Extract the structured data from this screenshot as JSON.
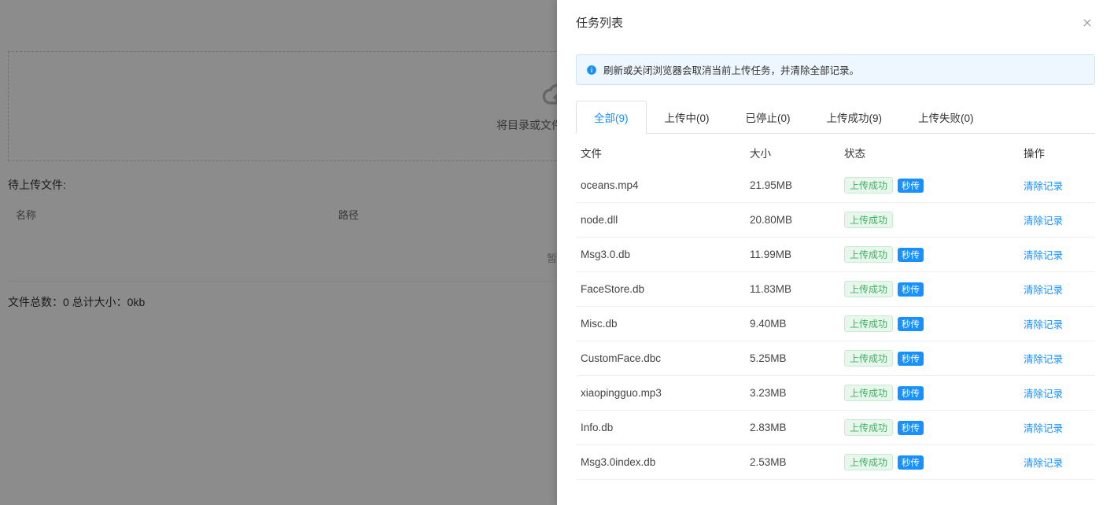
{
  "drawer": {
    "title": "任务列表",
    "alert": "刷新或关闭浏览器会取消当前上传任务，并清除全部记录。"
  },
  "tabs": [
    {
      "label": "全部(9)",
      "active": true
    },
    {
      "label": "上传中(0)",
      "active": false
    },
    {
      "label": "已停止(0)",
      "active": false
    },
    {
      "label": "上传成功(9)",
      "active": false
    },
    {
      "label": "上传失败(0)",
      "active": false
    }
  ],
  "columns": {
    "file": "文件",
    "size": "大小",
    "status": "状态",
    "action": "操作"
  },
  "status_labels": {
    "success": "上传成功",
    "instant": "秒传",
    "clear": "清除记录"
  },
  "tasks": [
    {
      "file": "oceans.mp4",
      "size": "21.95MB",
      "instant": true
    },
    {
      "file": "node.dll",
      "size": "20.80MB",
      "instant": false
    },
    {
      "file": "Msg3.0.db",
      "size": "11.99MB",
      "instant": true
    },
    {
      "file": "FaceStore.db",
      "size": "11.83MB",
      "instant": true
    },
    {
      "file": "Misc.db",
      "size": "9.40MB",
      "instant": true
    },
    {
      "file": "CustomFace.dbc",
      "size": "5.25MB",
      "instant": true
    },
    {
      "file": "xiaopingguo.mp3",
      "size": "3.23MB",
      "instant": true
    },
    {
      "file": "Info.db",
      "size": "2.83MB",
      "instant": true
    },
    {
      "file": "Msg3.0index.db",
      "size": "2.53MB",
      "instant": true
    }
  ],
  "background": {
    "dropzone_text": "将目录或文件拖拽到此处",
    "pending_label": "待上传文件:",
    "col_name": "名称",
    "col_path": "路径",
    "empty_text": "暂无",
    "totals": "文件总数：0 总计大小：0kb"
  }
}
